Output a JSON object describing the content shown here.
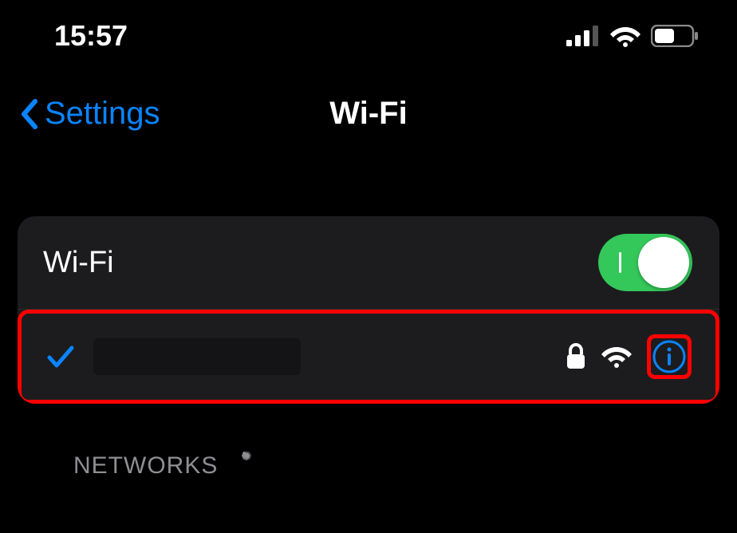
{
  "status": {
    "time": "15:57"
  },
  "nav": {
    "back_label": "Settings",
    "title": "Wi-Fi"
  },
  "wifi": {
    "toggle_label": "Wi-Fi",
    "toggle_on": true
  },
  "connected_network": {
    "name": ""
  },
  "sections": {
    "networks_label": "NETWORKS"
  }
}
